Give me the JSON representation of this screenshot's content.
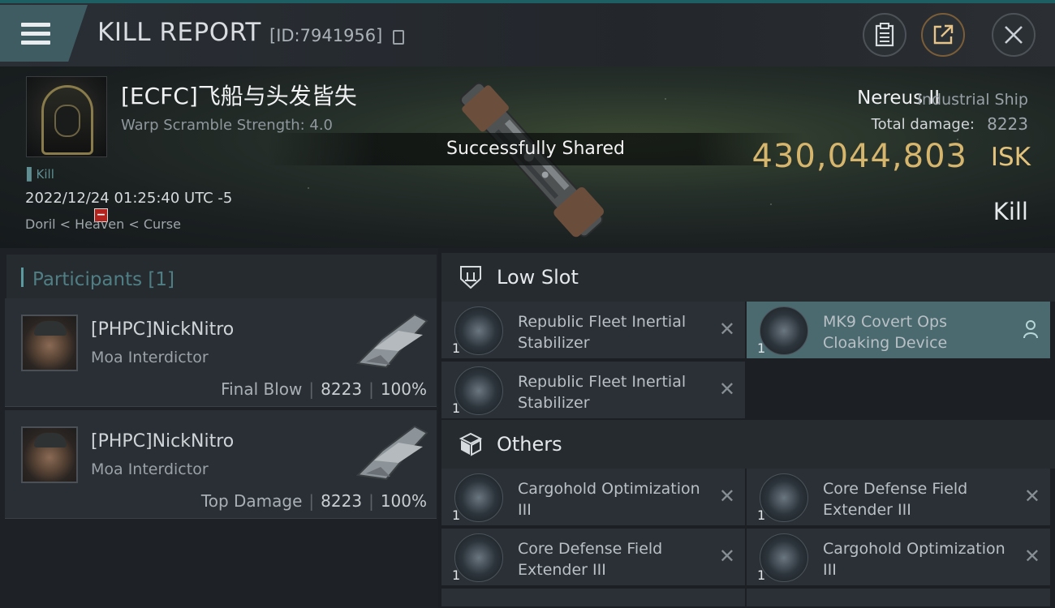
{
  "header": {
    "title": "KILL REPORT",
    "report_id": "[ID:7941956]",
    "buttons": {
      "clipboard_icon": "clipboard-icon",
      "share_icon": "share-icon",
      "close_icon": "close-icon"
    }
  },
  "victim": {
    "name": "[ECFC]飞船与头发皆失",
    "warp_scramble": "Warp Scramble Strength: 4.0",
    "kill_tag": "Kill",
    "timestamp": "2022/12/24 01:25:40 UTC -5",
    "location": "Doril < Heaven < Curse"
  },
  "toast": "Successfully Shared",
  "ship": {
    "name": "Nereus II",
    "class": "Industrial Ship",
    "total_damage_label": "Total damage:",
    "total_damage": "8223",
    "isk_value": "430,044,803",
    "isk_unit": "ISK",
    "result": "Kill"
  },
  "participants": {
    "header": "Participants",
    "count": "[1]",
    "cards": [
      {
        "name": "[PHPC]NickNitro",
        "ship": "Moa Interdictor",
        "role": "Final Blow",
        "damage": "8223",
        "percent": "100%"
      },
      {
        "name": "[PHPC]NickNitro",
        "ship": "Moa Interdictor",
        "role": "Top Damage",
        "damage": "8223",
        "percent": "100%"
      }
    ]
  },
  "fitting": {
    "low_slot": {
      "label": "Low Slot",
      "items": [
        {
          "name": "Republic Fleet Inertial Stabilizer",
          "qty": "1"
        },
        {
          "name": "MK9 Covert Ops Cloaking Device",
          "qty": "1"
        },
        {
          "name": "Republic Fleet Inertial Stabilizer",
          "qty": "1"
        }
      ]
    },
    "others": {
      "label": "Others",
      "items": [
        {
          "name": "Cargohold Optimization III",
          "qty": "1"
        },
        {
          "name": "Core Defense Field Extender III",
          "qty": "1"
        },
        {
          "name": "Core Defense Field Extender III",
          "qty": "1"
        },
        {
          "name": "Cargohold Optimization III",
          "qty": "1"
        }
      ]
    }
  },
  "colors": {
    "isk": "#d6b56d",
    "accent": "#4a6a6f",
    "alert": "#b3231e"
  }
}
